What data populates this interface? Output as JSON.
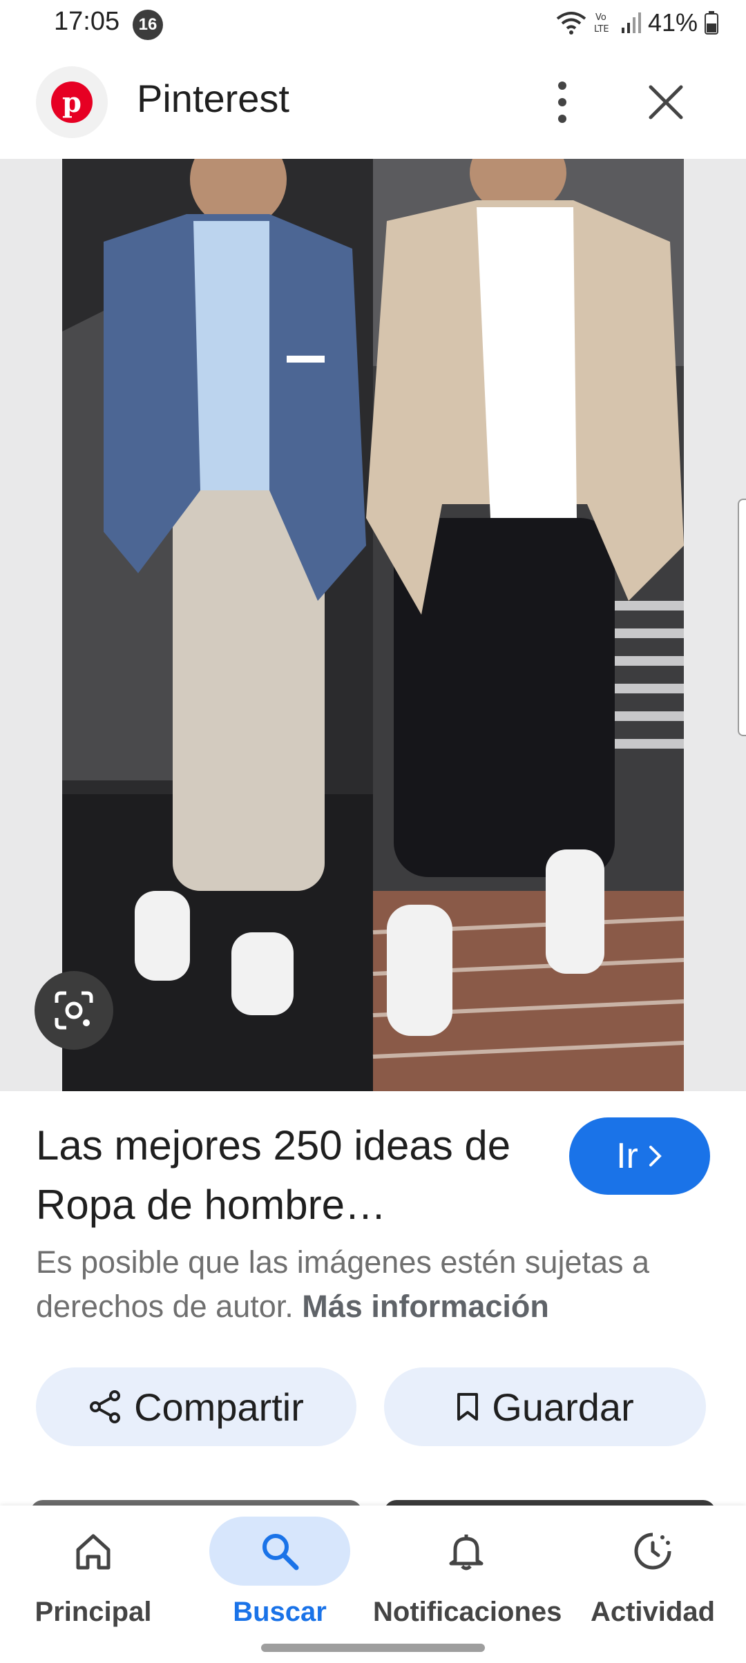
{
  "status_bar": {
    "time": "17:05",
    "notification_count": "16",
    "battery_percent": "41%",
    "icons": [
      "wifi-icon",
      "volte-icon",
      "signal-icon",
      "battery-icon"
    ]
  },
  "header": {
    "app_name": "Pinterest",
    "logo": "pinterest-logo",
    "menu_icon": "more-vert-icon",
    "close_icon": "close-icon"
  },
  "result": {
    "title": "Las mejores 250 ideas de Ropa de hombre…",
    "go_label": "Ir",
    "disclaimer": "Es posible que las imágenes estén sujetas a derechos de autor.",
    "more_info": "Más información"
  },
  "actions": {
    "share_label": "Compartir",
    "save_label": "Guardar"
  },
  "bottom_nav": {
    "items": [
      {
        "label": "Principal",
        "icon": "home-icon",
        "active": false
      },
      {
        "label": "Buscar",
        "icon": "search-icon",
        "active": true
      },
      {
        "label": "Notificaciones",
        "icon": "bell-icon",
        "active": false
      },
      {
        "label": "Actividad",
        "icon": "activity-icon",
        "active": false
      }
    ]
  },
  "colors": {
    "accent": "#1a73e8",
    "pinterest_red": "#e60023",
    "chip_bg": "#e8effb",
    "nav_active_bg": "#d7e6fc"
  }
}
